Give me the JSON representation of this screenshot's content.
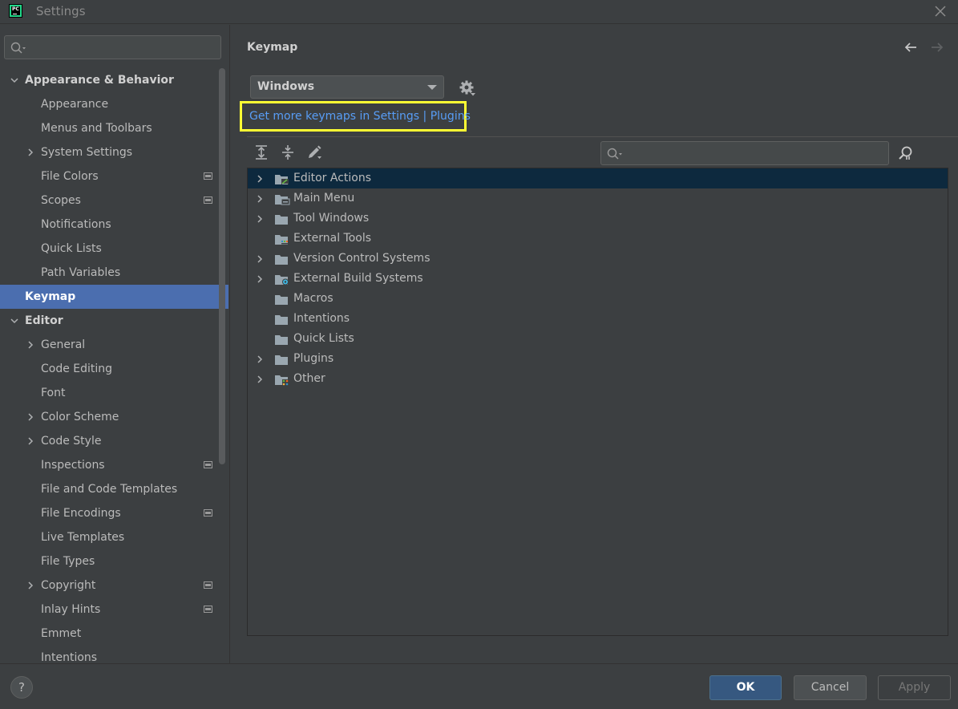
{
  "window": {
    "title": "Settings",
    "logo_text": "PC"
  },
  "sidebar": {
    "search_placeholder": "",
    "items": [
      {
        "label": "Appearance & Behavior",
        "level": 0,
        "expand": "open",
        "bold": true,
        "name": "sidebar-item-appearance-behavior"
      },
      {
        "label": "Appearance",
        "level": 1,
        "expand": "none",
        "name": "sidebar-item-appearance"
      },
      {
        "label": "Menus and Toolbars",
        "level": 1,
        "expand": "none",
        "name": "sidebar-item-menus-toolbars"
      },
      {
        "label": "System Settings",
        "level": 1,
        "expand": "closed",
        "name": "sidebar-item-system-settings"
      },
      {
        "label": "File Colors",
        "level": 1,
        "expand": "none",
        "project": true,
        "name": "sidebar-item-file-colors"
      },
      {
        "label": "Scopes",
        "level": 1,
        "expand": "none",
        "project": true,
        "name": "sidebar-item-scopes"
      },
      {
        "label": "Notifications",
        "level": 1,
        "expand": "none",
        "name": "sidebar-item-notifications"
      },
      {
        "label": "Quick Lists",
        "level": 1,
        "expand": "none",
        "name": "sidebar-item-quick-lists"
      },
      {
        "label": "Path Variables",
        "level": 1,
        "expand": "none",
        "name": "sidebar-item-path-variables"
      },
      {
        "label": "Keymap",
        "level": 0,
        "expand": "none",
        "bold": true,
        "selected": true,
        "name": "sidebar-item-keymap"
      },
      {
        "label": "Editor",
        "level": 0,
        "expand": "open",
        "bold": true,
        "name": "sidebar-item-editor"
      },
      {
        "label": "General",
        "level": 1,
        "expand": "closed",
        "name": "sidebar-item-general"
      },
      {
        "label": "Code Editing",
        "level": 1,
        "expand": "none",
        "name": "sidebar-item-code-editing"
      },
      {
        "label": "Font",
        "level": 1,
        "expand": "none",
        "name": "sidebar-item-font"
      },
      {
        "label": "Color Scheme",
        "level": 1,
        "expand": "closed",
        "name": "sidebar-item-color-scheme"
      },
      {
        "label": "Code Style",
        "level": 1,
        "expand": "closed",
        "name": "sidebar-item-code-style"
      },
      {
        "label": "Inspections",
        "level": 1,
        "expand": "none",
        "project": true,
        "name": "sidebar-item-inspections"
      },
      {
        "label": "File and Code Templates",
        "level": 1,
        "expand": "none",
        "name": "sidebar-item-file-code-templates"
      },
      {
        "label": "File Encodings",
        "level": 1,
        "expand": "none",
        "project": true,
        "name": "sidebar-item-file-encodings"
      },
      {
        "label": "Live Templates",
        "level": 1,
        "expand": "none",
        "name": "sidebar-item-live-templates"
      },
      {
        "label": "File Types",
        "level": 1,
        "expand": "none",
        "name": "sidebar-item-file-types"
      },
      {
        "label": "Copyright",
        "level": 1,
        "expand": "closed",
        "project": true,
        "name": "sidebar-item-copyright"
      },
      {
        "label": "Inlay Hints",
        "level": 1,
        "expand": "none",
        "project": true,
        "name": "sidebar-item-inlay-hints"
      },
      {
        "label": "Emmet",
        "level": 1,
        "expand": "none",
        "name": "sidebar-item-emmet"
      },
      {
        "label": "Intentions",
        "level": 1,
        "expand": "none",
        "name": "sidebar-item-intentions"
      }
    ]
  },
  "content": {
    "title": "Keymap",
    "keymap_select": {
      "value": "Windows"
    },
    "plugins_link": "Get more keymaps in Settings | Plugins",
    "actions_search_placeholder": "",
    "actions": [
      {
        "label": "Editor Actions",
        "expandable": true,
        "selected": true,
        "icon": "editor-folder-icon",
        "name": "action-editor-actions"
      },
      {
        "label": "Main Menu",
        "expandable": true,
        "icon": "menu-folder-icon",
        "name": "action-main-menu"
      },
      {
        "label": "Tool Windows",
        "expandable": true,
        "icon": "folder-icon",
        "name": "action-tool-windows"
      },
      {
        "label": "External Tools",
        "expandable": false,
        "icon": "tools-folder-icon",
        "name": "action-external-tools"
      },
      {
        "label": "Version Control Systems",
        "expandable": true,
        "icon": "folder-icon",
        "name": "action-version-control-systems"
      },
      {
        "label": "External Build Systems",
        "expandable": true,
        "icon": "gear-folder-icon",
        "name": "action-external-build-systems"
      },
      {
        "label": "Macros",
        "expandable": false,
        "icon": "folder-icon",
        "name": "action-macros"
      },
      {
        "label": "Intentions",
        "expandable": false,
        "icon": "folder-icon",
        "name": "action-intentions"
      },
      {
        "label": "Quick Lists",
        "expandable": false,
        "icon": "folder-icon",
        "name": "action-quick-lists"
      },
      {
        "label": "Plugins",
        "expandable": true,
        "icon": "folder-icon",
        "name": "action-plugins"
      },
      {
        "label": "Other",
        "expandable": true,
        "icon": "other-folder-icon",
        "name": "action-other"
      }
    ]
  },
  "footer": {
    "help_label": "?",
    "ok_label": "OK",
    "cancel_label": "Cancel",
    "apply_label": "Apply"
  },
  "colors": {
    "background": "#3c3f41",
    "selection": "#4b6eaf",
    "tree_selection": "#0d293e",
    "link": "#589df6",
    "highlight_box": "#ffff33",
    "ok_button": "#365880"
  }
}
